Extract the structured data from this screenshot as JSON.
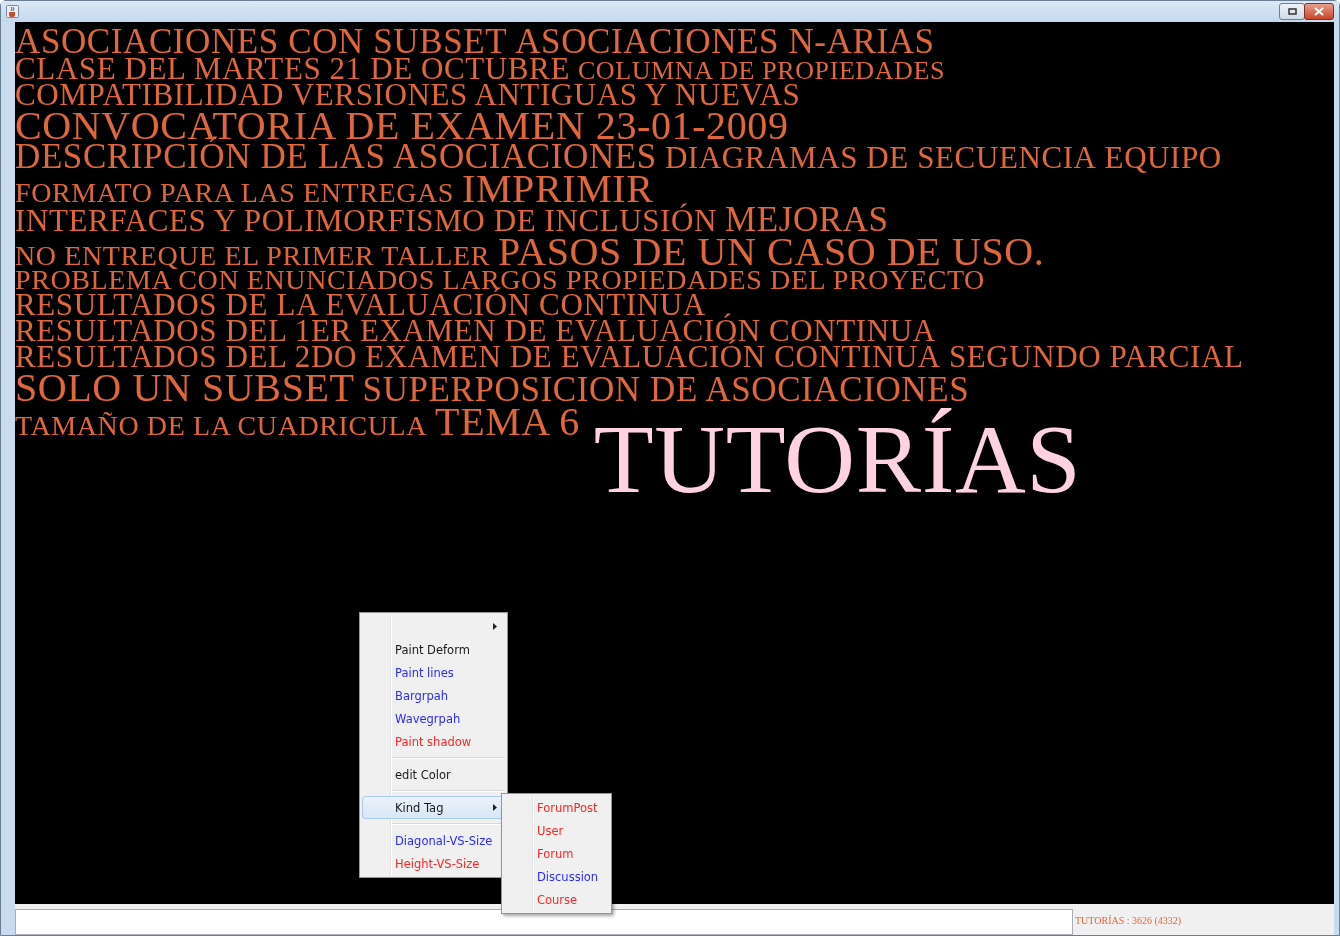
{
  "tag_cloud": {
    "lines": [
      [
        {
          "label": "ASOCIACIONES CON SUBSET",
          "kind": "large",
          "selected": false
        },
        {
          "label": "ASOCIACIONES N-ARIAS",
          "kind": "large",
          "selected": false
        }
      ],
      [
        {
          "label": "CLASE DEL MARTES 21 DE OCTUBRE",
          "kind": "medium",
          "selected": false
        },
        {
          "label": "COLUMNA DE PROPIEDADES",
          "kind": "tiny",
          "selected": false
        }
      ],
      [
        {
          "label": "COMPATIBILIDAD VERSIONES ANTIGUAS Y NUEVAS",
          "kind": "medium",
          "selected": false
        }
      ],
      [
        {
          "label": "CONVOCATORIA DE EXAMEN 23-01-2009",
          "kind": "huge",
          "selected": false
        }
      ],
      [
        {
          "label": "DESCRIPCIÓN DE LAS ASOCIACIONES",
          "kind": "large",
          "selected": false
        },
        {
          "label": "DIAGRAMAS DE SECUENCIA",
          "kind": "medium",
          "selected": false
        },
        {
          "label": "EQUIPO",
          "kind": "medium",
          "selected": false
        }
      ],
      [
        {
          "label": "FORMATO PARA LAS ENTREGAS",
          "kind": "small",
          "selected": false
        },
        {
          "label": "IMPRIMIR",
          "kind": "huge",
          "selected": false
        }
      ],
      [
        {
          "label": "INTERFACES Y POLIMORFISMO DE INCLUSIÓN",
          "kind": "medium",
          "selected": false
        },
        {
          "label": "MEJORAS",
          "kind": "large",
          "selected": false
        }
      ],
      [
        {
          "label": "NO ENTREQUE EL PRIMER TALLER",
          "kind": "small",
          "selected": false
        },
        {
          "label": "PASOS DE UN CASO DE USO.",
          "kind": "huge",
          "selected": false
        }
      ],
      [
        {
          "label": "PROBLEMA CON ENUNCIADOS LARGOS",
          "kind": "small",
          "selected": false
        },
        {
          "label": "PROPIEDADES DEL PROYECTO",
          "kind": "small",
          "selected": false
        }
      ],
      [
        {
          "label": "RESULTADOS DE LA EVALUACIÓN CONTINUA",
          "kind": "medium",
          "selected": false
        }
      ],
      [
        {
          "label": "RESULTADOS DEL 1ER EXAMEN DE EVALUACIÓN CONTINUA",
          "kind": "medium",
          "selected": false
        }
      ],
      [
        {
          "label": "RESULTADOS DEL 2DO EXAMEN DE EVALUACIÓN CONTINUA",
          "kind": "medium",
          "selected": false
        },
        {
          "label": "SEGUNDO PARCIAL",
          "kind": "medium",
          "selected": false
        }
      ],
      [
        {
          "label": "SOLO UN SUBSET",
          "kind": "huge",
          "selected": false
        },
        {
          "label": "SUPERPOSICION DE ASOCIACIONES",
          "kind": "large",
          "selected": false
        }
      ],
      [
        {
          "label": "TAMAÑO DE LA CUADRICULA",
          "kind": "small",
          "selected": false
        },
        {
          "label": "TEMA 6",
          "kind": "huge",
          "selected": false
        },
        {
          "label": "TUTORÍAS",
          "kind": "giant",
          "selected": true
        }
      ]
    ]
  },
  "context_menu": {
    "items": [
      {
        "kind": "submenu",
        "selected": false
      },
      {
        "kind": "item",
        "label": "Paint Deform",
        "color": "#1a1a1a",
        "selected": false
      },
      {
        "kind": "item",
        "label": "Paint lines",
        "color": "#2b2bff",
        "selected": false
      },
      {
        "kind": "item",
        "label": "Bargrpah",
        "color": "#2b2bff",
        "selected": false
      },
      {
        "kind": "item",
        "label": "Wavegrpah",
        "color": "#2b2bff",
        "selected": false
      },
      {
        "kind": "item",
        "label": "Paint shadow",
        "color": "#ff2626",
        "selected": false
      },
      {
        "kind": "separator"
      },
      {
        "kind": "item",
        "label": "edit Color",
        "color": "#1a1a1a",
        "selected": false
      },
      {
        "kind": "separator"
      },
      {
        "kind": "submenu",
        "label": "Kind Tag",
        "color": "#1a1a1a",
        "selected": true
      },
      {
        "kind": "separator"
      },
      {
        "kind": "item",
        "label": "Diagonal-VS-Size",
        "color": "#2b2bff",
        "selected": false
      },
      {
        "kind": "item",
        "label": "Height-VS-Size",
        "color": "#ff2626",
        "selected": false
      }
    ]
  },
  "submenu": {
    "items": [
      {
        "kind": "item",
        "label": "ForumPost",
        "color": "#ff2626",
        "selected": false
      },
      {
        "kind": "item",
        "label": "User",
        "color": "#ff2626",
        "selected": false
      },
      {
        "kind": "item",
        "label": "Forum",
        "color": "#ff2626",
        "selected": false
      },
      {
        "kind": "item",
        "label": "Discussion",
        "color": "#2b2bff",
        "selected": false
      },
      {
        "kind": "item",
        "label": "Course",
        "color": "#ff2626",
        "selected": false
      }
    ]
  },
  "status_bar": {
    "text": "TUTORÍAS : 3626 (4332)"
  }
}
